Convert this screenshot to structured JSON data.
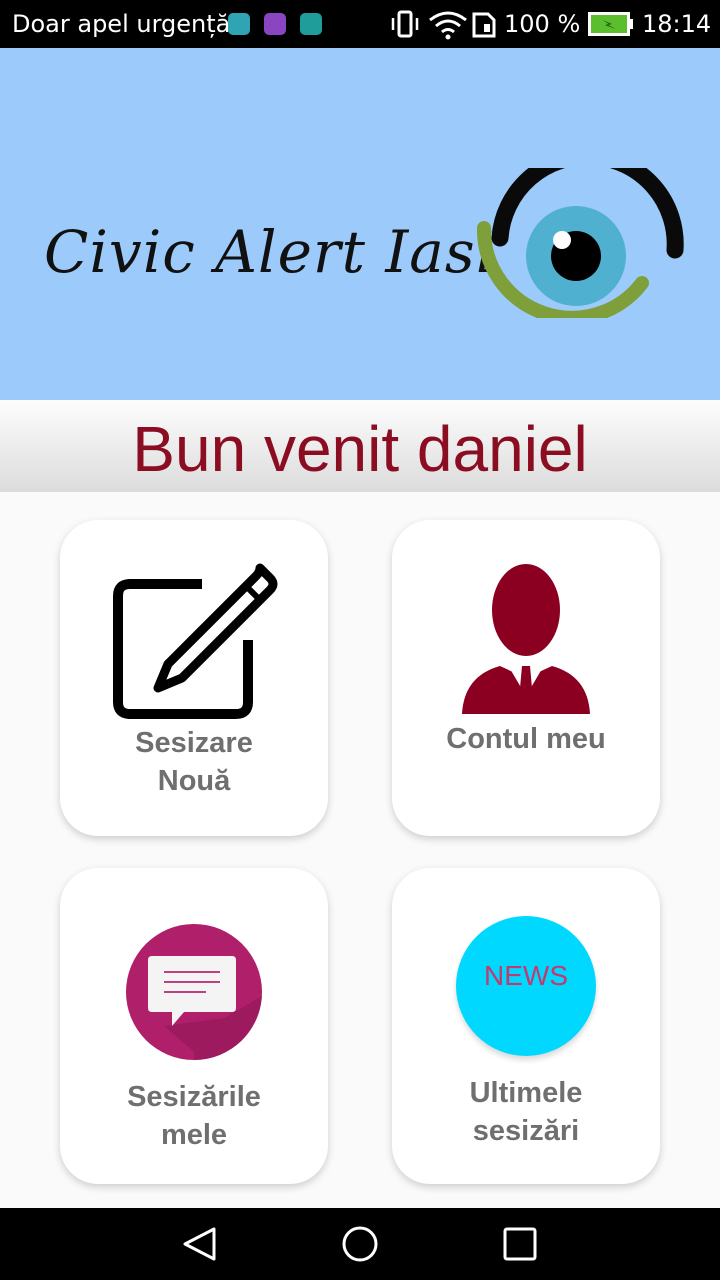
{
  "status_bar": {
    "carrier": "Doar apel urgență",
    "battery_percent": "100 %",
    "time": "18:14",
    "icons": [
      "app-notification-icon",
      "gallery-notification-icon",
      "shield-notification-icon",
      "vibrate-icon",
      "wifi-icon",
      "sim-icon",
      "battery-charging-icon"
    ]
  },
  "header": {
    "logo_text": "Civic Alert Iasi",
    "background_color": "#9ccbfb"
  },
  "welcome": {
    "text": "Bun venit daniel",
    "color": "#8b0d22"
  },
  "tiles": [
    {
      "line1": "Sesizare",
      "line2": "Nouă",
      "icon": "edit-note-icon"
    },
    {
      "line1": "Contul meu",
      "line2": "",
      "icon": "user-account-icon"
    },
    {
      "line1": "Sesizările",
      "line2": "mele",
      "icon": "chat-bubble-icon"
    },
    {
      "line1": "Ultimele",
      "line2": "sesizări",
      "icon": "news-icon",
      "icon_text": "NEWS"
    }
  ],
  "nav_bar": {
    "icons": [
      "back-icon",
      "home-icon",
      "recents-icon"
    ]
  }
}
